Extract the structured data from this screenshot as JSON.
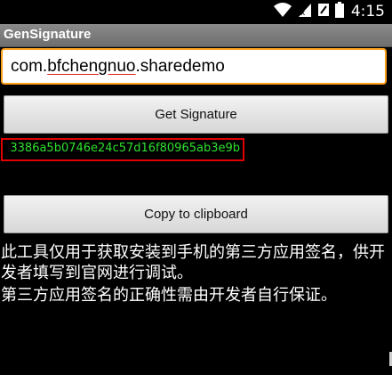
{
  "status_bar": {
    "time": "4:15",
    "icons": [
      "wifi-icon",
      "signal-icon",
      "notification-icon",
      "battery-icon"
    ]
  },
  "app": {
    "title": "GenSignature"
  },
  "package_input": {
    "value_prefix": "com.",
    "value_underlined": "bfchengnuo",
    "value_suffix": ".sharedemo"
  },
  "buttons": {
    "get_signature": "Get Signature",
    "copy_clipboard": "Copy to clipboard"
  },
  "signature": {
    "value": "3386a5b0746e24c57d16f80965ab3e9b"
  },
  "info": {
    "line1": "此工具仅用于获取安装到手机的第三方应用签名，供开发者填写到官网进行调试。",
    "line2": "第三方应用签名的正确性需由开发者自行保证。"
  },
  "colors": {
    "background": "#000000",
    "title_bar": "#7b7b7b",
    "input_focus_border": "#ff9f1a",
    "signature_text": "#2ee02e",
    "highlight_box": "#e00000"
  }
}
